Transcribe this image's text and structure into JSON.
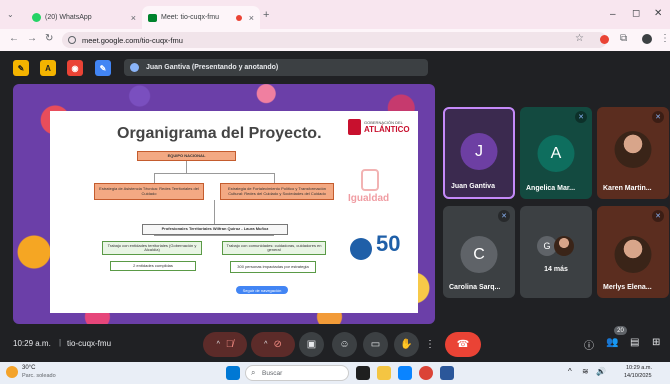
{
  "browser": {
    "tabs": [
      {
        "title": "(20) WhatsApp",
        "active": false
      },
      {
        "title": "Meet: tio-cuqx-fmu",
        "active": true
      }
    ],
    "url": "meet.google.com/tio-cuqx-fmu"
  },
  "meet": {
    "presenter_banner": "Juan Gantiva (Presentando y anotando)",
    "meeting_time": "10:29 a.m.",
    "meeting_code": "tio-cuqx-fmu",
    "participant_count": "20"
  },
  "slide": {
    "title": "Organigrama del Proyecto.",
    "logo_gov_line1": "GOBERNACIÓN DEL",
    "logo_gov_line2": "ATLÁNTICO",
    "logo_igualdad": "Igualdad",
    "logo_50": "50",
    "top_box": "EQUIPO NACIONAL",
    "left_box": "Estrategia de Asistencia Técnica: Redes Territoriales del Cuidado",
    "right_box": "Estrategia de Fortalecimiento Político y Transformación Cultural: Redes del Cuidado y Sociedades del Cuidado",
    "mid_box": "Profesionales Territoriales Wilfran Quiroz - Laura Muñoz",
    "green_left": "Trabajo con entidades territoriales (Gobernación y Alcaldía)",
    "green_right": "Trabajo con comunidades: cuidadoras, cuidadores en general",
    "green_left_stat": "2 entidades cumplidas",
    "green_right_stat": "300 personas impactadas por estrategia",
    "slide_footer_btn": "Seguir de navegación"
  },
  "participants": [
    {
      "name": "Juan Gantiva",
      "initial": "J",
      "color": "#6d3fa3",
      "tile_bg": "#3b2a4f"
    },
    {
      "name": "Angelica Mar...",
      "initial": "A",
      "color": "#0e6e5e",
      "tile_bg": "#134a40"
    },
    {
      "name": "Karen Martin...",
      "initial": "",
      "color": "#7a3520",
      "tile_bg": "#5b2d1f"
    },
    {
      "name": "Carolina Sarq...",
      "initial": "C",
      "color": "#5f6368",
      "tile_bg": "#3c4043"
    },
    {
      "name": "14 más",
      "initial": "G",
      "color": "#5f6368",
      "tile_bg": "#3c4043"
    },
    {
      "name": "Merlys Elena...",
      "initial": "",
      "color": "#7a3520",
      "tile_bg": "#5b2d1f"
    }
  ],
  "taskbar": {
    "weather_temp": "30°C",
    "weather_desc": "Parc. soleado",
    "search_placeholder": "Buscar",
    "clock_time": "10:29 a.m.",
    "clock_date": "14/10/2025"
  },
  "colors": {
    "meet_bg": "#202124",
    "end_call": "#ea4335",
    "tab_strip": "#f8e6ef"
  }
}
